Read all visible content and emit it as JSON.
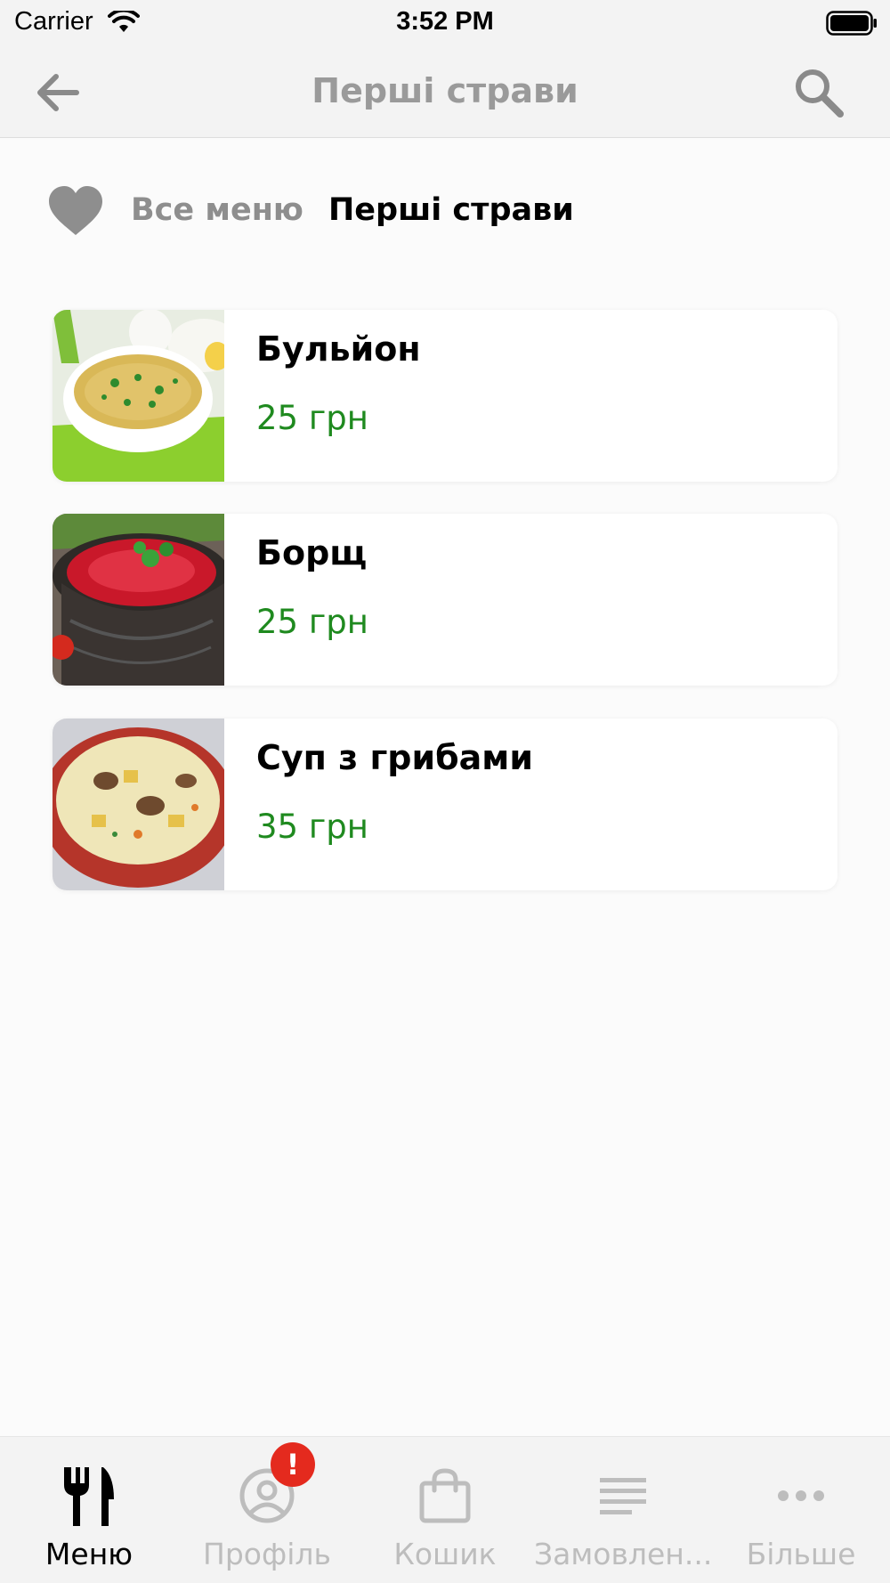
{
  "status_bar": {
    "carrier": "Carrier",
    "time": "3:52 PM"
  },
  "nav": {
    "title": "Перші страви",
    "back_icon": "arrow-left-icon",
    "search_icon": "search-icon"
  },
  "breadcrumb": {
    "favorite_icon": "heart-icon",
    "all_menu": "Все меню",
    "current": "Перші страви"
  },
  "dishes": [
    {
      "name": "Бульйон",
      "price": "25 грн"
    },
    {
      "name": "Борщ",
      "price": "25 грн"
    },
    {
      "name": "Суп з грибами",
      "price": "35 грн"
    }
  ],
  "tabs": [
    {
      "label": "Меню",
      "icon": "fork-knife-icon",
      "active": true
    },
    {
      "label": "Профіль",
      "icon": "profile-icon",
      "badge": "!"
    },
    {
      "label": "Кошик",
      "icon": "shopping-bag-icon"
    },
    {
      "label": "Замовлен...",
      "icon": "list-icon"
    },
    {
      "label": "Більше",
      "icon": "more-icon"
    }
  ],
  "colors": {
    "price": "#1f8a1f",
    "badge": "#e42a1e",
    "inactive": "#bdbdbd",
    "nav_title": "#9a9a9a"
  }
}
